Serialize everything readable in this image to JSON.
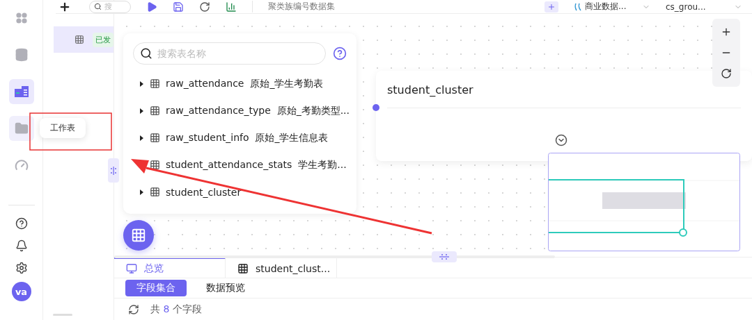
{
  "rail": {
    "items": [
      {
        "kind": "apps",
        "selected": false,
        "hovered": false
      },
      {
        "kind": "database",
        "selected": false,
        "hovered": false
      },
      {
        "kind": "worksheet",
        "selected": true,
        "hovered": false
      },
      {
        "kind": "folder",
        "selected": false,
        "hovered": true
      },
      {
        "kind": "gauge",
        "selected": false,
        "hovered": false
      }
    ],
    "bottom": [
      {
        "kind": "help"
      },
      {
        "kind": "bell"
      },
      {
        "kind": "settings"
      }
    ],
    "avatar": "va"
  },
  "tooltip": "工作表",
  "side_panel": {
    "item": {
      "badge": "已发"
    }
  },
  "toolbar": {
    "search_placeholder": "搜",
    "title": "聚类族编号数据集",
    "source": "商业数据...",
    "schema": "cs_grou..."
  },
  "table_list": {
    "search_placeholder": "搜索表名称",
    "tables": [
      {
        "name": "raw_attendance",
        "comment": "原始_学生考勤表",
        "expanded": false
      },
      {
        "name": "raw_attendance_type",
        "comment": "原始_考勤类型...",
        "expanded": false
      },
      {
        "name": "raw_student_info",
        "comment": "原始_学生信息表",
        "expanded": false
      },
      {
        "name": "student_attendance_stats",
        "comment": "学生考勤..."
      },
      {
        "name": "student_cluster",
        "expanded": false
      }
    ]
  },
  "node": {
    "title": "student_cluster"
  },
  "bottom": {
    "tabs": [
      {
        "label": "总览",
        "kind": "overview",
        "selected": true
      },
      {
        "label": "student_clust...",
        "kind": "table",
        "selected": false
      }
    ],
    "subtabs": [
      {
        "label": "字段集合",
        "selected": true
      },
      {
        "label": "数据预览",
        "selected": false
      }
    ],
    "field_count": {
      "prefix": "共",
      "count": "8",
      "suffix": "个字段"
    }
  }
}
